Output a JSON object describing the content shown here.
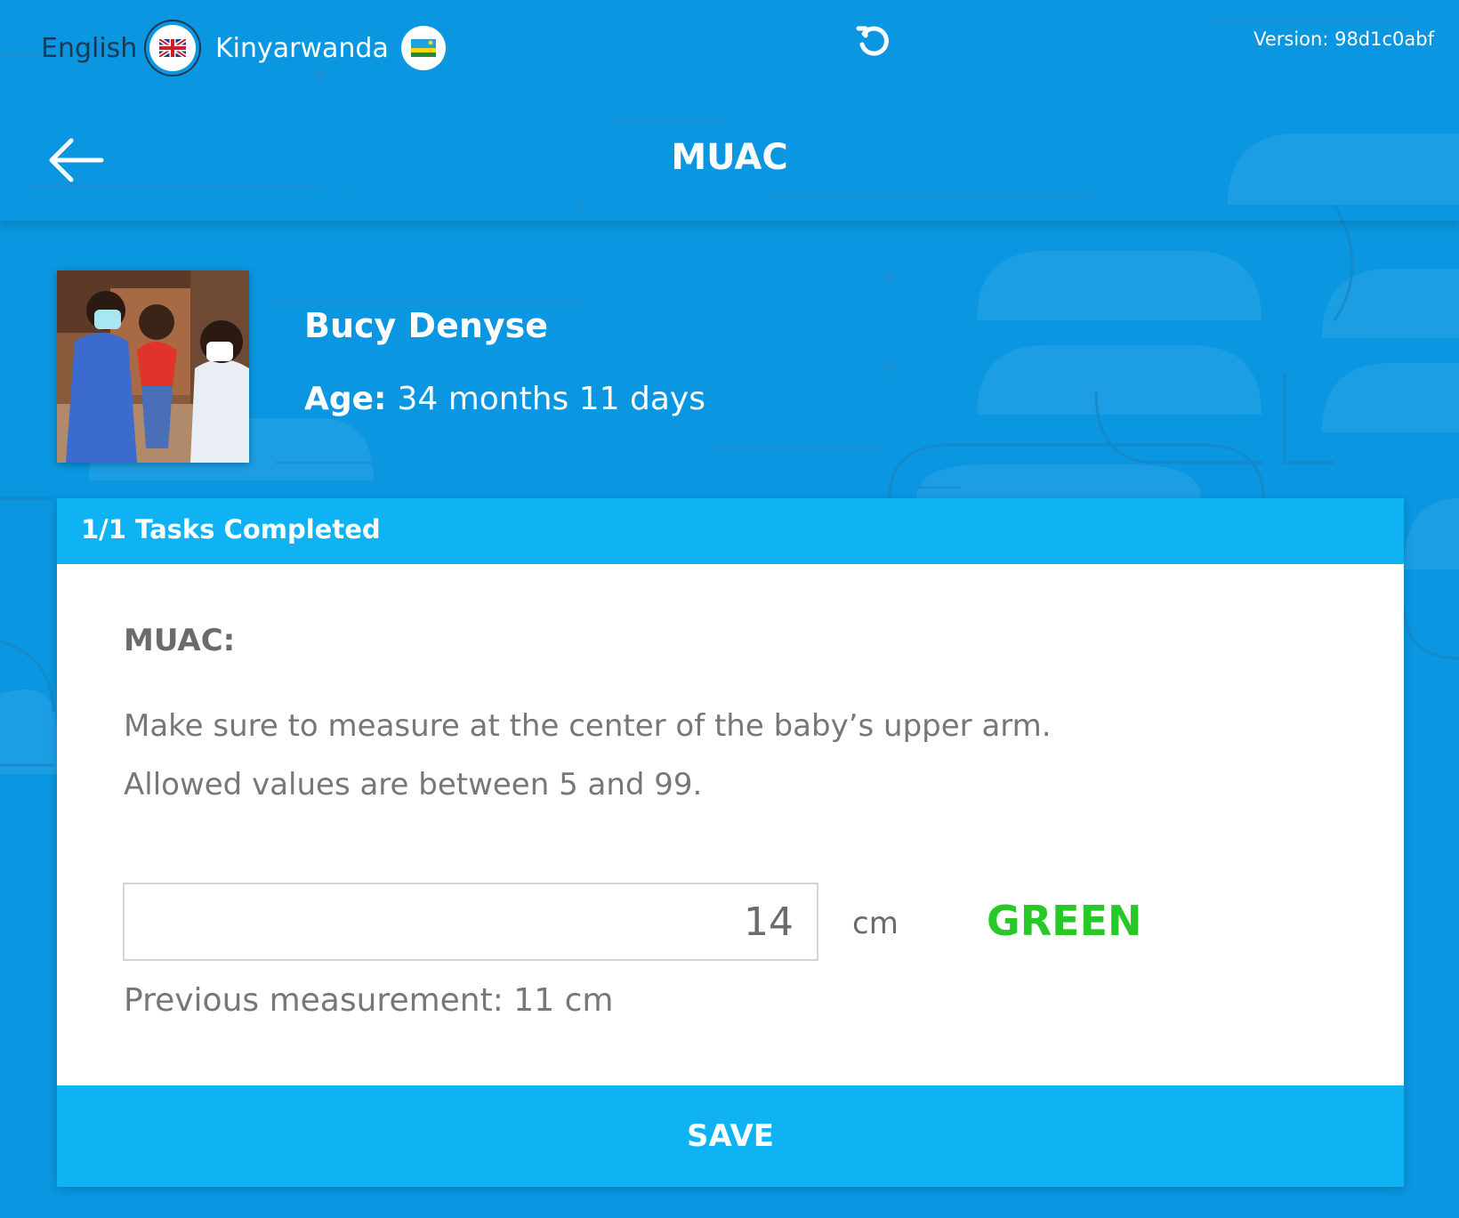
{
  "languages": [
    {
      "label": "English",
      "flag": "uk-flag-icon",
      "active": true
    },
    {
      "label": "Kinyarwanda",
      "flag": "rwanda-flag-icon",
      "active": false
    }
  ],
  "version": "Version: 98d1c0abf",
  "header": {
    "title": "MUAC"
  },
  "patient": {
    "name": "Bucy Denyse",
    "age_label": "Age:",
    "age_value": "34 months 11 days"
  },
  "card": {
    "tasks_completed": "1/1 Tasks Completed",
    "question_label": "MUAC:",
    "help_line_1": "Make sure to measure at the center of the baby’s upper arm.",
    "help_line_2": "Allowed values are between 5 and 99.",
    "input_value": "14",
    "unit": "cm",
    "zone": "GREEN",
    "previous": "Previous measurement: 11 cm",
    "save_label": "SAVE"
  },
  "colors": {
    "background": "#0a96e0",
    "accent": "#0fb3f4",
    "zone_green": "#27c827"
  }
}
